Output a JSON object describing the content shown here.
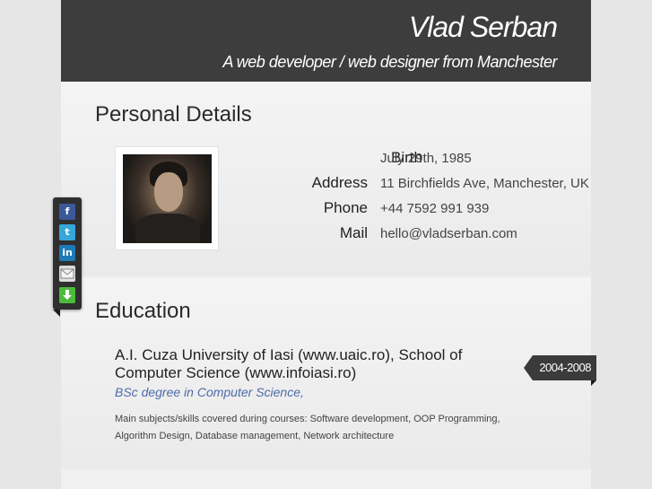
{
  "header": {
    "name": "Vlad Serban",
    "tagline": "A web developer / web designer from Manchester"
  },
  "personal": {
    "title": "Personal Details",
    "details": [
      {
        "label": "Birth",
        "value": "July 29th, 1985"
      },
      {
        "label": "Address",
        "value": "11 Birchfields Ave, Manchester, UK"
      },
      {
        "label": "Phone",
        "value": "+44 7592 991 939"
      },
      {
        "label": "Mail",
        "value": "hello@vladserban.com"
      }
    ]
  },
  "share": {
    "icons": [
      "facebook-icon",
      "twitter-icon",
      "linkedin-icon",
      "email-icon",
      "download-icon"
    ]
  },
  "education": {
    "title": "Education",
    "entry": {
      "school": "A.I. Cuza University of Iasi (www.uaic.ro), School of Computer Science (www.infoiasi.ro)",
      "degree": "BSc degree in Computer Science,",
      "description": "Main subjects/skills covered during courses: Software development, OOP Programming, Algorithm Design, Database management, Network architecture",
      "period": "2004-2008"
    }
  },
  "colors": {
    "header_bg": "#3d3d3d",
    "page_bg": "#f1f1f1",
    "body_bg": "#e6e6e6",
    "degree_text": "#4d6ba8",
    "date_tag_bg": "#3b3b3b"
  }
}
